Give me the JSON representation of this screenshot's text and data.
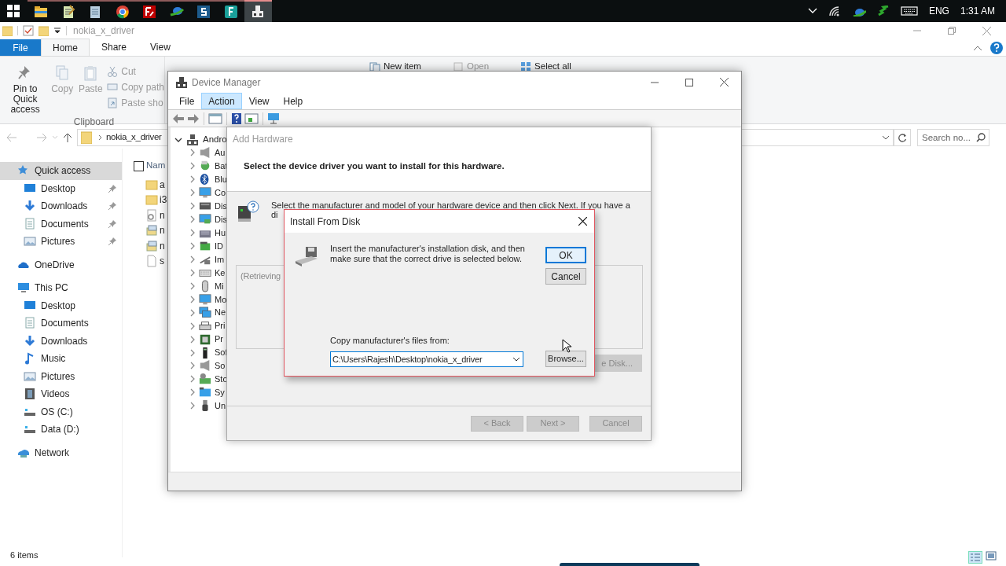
{
  "taskbar": {
    "apps": [
      {
        "kind": "explorer",
        "selected": false
      },
      {
        "kind": "notepad",
        "selected": false
      },
      {
        "kind": "notes",
        "selected": false
      },
      {
        "kind": "browser",
        "selected": false
      },
      {
        "kind": "ftp",
        "selected": false
      },
      {
        "kind": "download",
        "selected": false
      },
      {
        "kind": "letter-s",
        "selected": false
      },
      {
        "kind": "letter-f",
        "selected": false
      },
      {
        "kind": "device",
        "selected": true
      }
    ],
    "tray": {
      "language": "ENG",
      "time": "1:31 AM"
    }
  },
  "explorer": {
    "title": "nokia_x_driver",
    "tabs": [
      {
        "label": "File",
        "kind": "file"
      },
      {
        "label": "Home",
        "kind": "tab",
        "selected": true
      },
      {
        "label": "Share",
        "kind": "tab",
        "selected": false
      },
      {
        "label": "View",
        "kind": "tab",
        "selected": false
      }
    ],
    "ribbon": {
      "large": [
        {
          "label": "Pin to Quick access",
          "kind": "pin",
          "disabled": false
        },
        {
          "label": "Copy",
          "kind": "copy",
          "disabled": true
        },
        {
          "label": "Paste",
          "kind": "paste",
          "disabled": true
        }
      ],
      "small": [
        {
          "label": "Cut",
          "kind": "cut",
          "disabled": true
        },
        {
          "label": "Copy path",
          "kind": "path",
          "disabled": true
        },
        {
          "label": "Paste sho",
          "kind": "shortcut",
          "disabled": true
        }
      ],
      "group_label": "Clipboard",
      "more": [
        {
          "label": "New item",
          "kind": "new",
          "disabled": false
        },
        {
          "label": "Open",
          "kind": "open",
          "disabled": true
        },
        {
          "label": "Select all",
          "kind": "selectall",
          "disabled": false
        }
      ]
    },
    "address": "nokia_x_driver",
    "search_placeholder": "Search no...",
    "nav": [
      {
        "label": "Quick access",
        "kind": "star",
        "selected": true,
        "children": [
          {
            "label": "Desktop",
            "kind": "desktop",
            "pinned": true
          },
          {
            "label": "Downloads",
            "kind": "downloads",
            "pinned": true
          },
          {
            "label": "Documents",
            "kind": "documents",
            "pinned": true
          },
          {
            "label": "Pictures",
            "kind": "pictures",
            "pinned": true
          }
        ]
      },
      {
        "label": "OneDrive",
        "kind": "cloud",
        "selected": false
      },
      {
        "label": "This PC",
        "kind": "pc",
        "selected": false,
        "children": [
          {
            "label": "Desktop",
            "kind": "desktop",
            "pinned": false
          },
          {
            "label": "Documents",
            "kind": "documents",
            "pinned": false
          },
          {
            "label": "Downloads",
            "kind": "downloads",
            "pinned": false
          },
          {
            "label": "Music",
            "kind": "music",
            "pinned": false
          },
          {
            "label": "Pictures",
            "kind": "pictures",
            "pinned": false
          },
          {
            "label": "Videos",
            "kind": "videos",
            "pinned": false
          },
          {
            "label": "OS (C:)",
            "kind": "drive",
            "pinned": false
          },
          {
            "label": "Data (D:)",
            "kind": "drive",
            "pinned": false
          }
        ]
      },
      {
        "label": "Network",
        "kind": "network",
        "selected": false
      }
    ],
    "select_all_checked": false,
    "list_header": "Nam",
    "files": [
      {
        "name": "a",
        "kind": "folder"
      },
      {
        "name": "i3",
        "kind": "folder"
      },
      {
        "name": "n",
        "kind": "settings"
      },
      {
        "name": "n",
        "kind": "setup"
      },
      {
        "name": "n",
        "kind": "setup"
      },
      {
        "name": "s",
        "kind": "file"
      }
    ],
    "status": "6 items"
  },
  "device_manager": {
    "title": "Device Manager",
    "menu": [
      {
        "label": "File",
        "selected": false
      },
      {
        "label": "Action",
        "selected": true
      },
      {
        "label": "View",
        "selected": false
      },
      {
        "label": "Help",
        "selected": false
      }
    ],
    "tree": {
      "label": "Andro",
      "expanded": true,
      "children": [
        {
          "label": "Au",
          "kind": "speaker"
        },
        {
          "label": "Bat",
          "kind": "battery"
        },
        {
          "label": "Blu",
          "kind": "bluetooth"
        },
        {
          "label": "Co",
          "kind": "monitor"
        },
        {
          "label": "Dis",
          "kind": "disk"
        },
        {
          "label": "Dis",
          "kind": "display"
        },
        {
          "label": "Hu",
          "kind": "hid"
        },
        {
          "label": "ID",
          "kind": "ide"
        },
        {
          "label": "Im",
          "kind": "camera"
        },
        {
          "label": "Ke",
          "kind": "keyboard"
        },
        {
          "label": "Mi",
          "kind": "mouse"
        },
        {
          "label": "Mo",
          "kind": "monitor"
        },
        {
          "label": "Ne",
          "kind": "network"
        },
        {
          "label": "Pri",
          "kind": "printer"
        },
        {
          "label": "Pr",
          "kind": "chip"
        },
        {
          "label": "Sof",
          "kind": "tower"
        },
        {
          "label": "So",
          "kind": "speaker"
        },
        {
          "label": "Sto",
          "kind": "storage"
        },
        {
          "label": "Sy",
          "kind": "folder"
        },
        {
          "label": "Un",
          "kind": "usb"
        }
      ]
    }
  },
  "add_hardware": {
    "title": "Add Hardware",
    "heading": "Select the device driver you want to install for this hardware.",
    "description": [
      "Select the manufacturer and model of your hardware device and then click Next. If you have a",
      "di"
    ],
    "list_text": "(Retrieving",
    "have_disk": "e Disk...",
    "buttons": [
      {
        "label": "< Back",
        "disabled": true
      },
      {
        "label": "Next >",
        "disabled": true
      },
      {
        "label": "Cancel",
        "disabled": true
      }
    ]
  },
  "install_from_disk": {
    "title": "Install From Disk",
    "message": "Insert the manufacturer's installation disk, and then make sure that the correct drive is selected below.",
    "buttons": [
      {
        "label": "OK",
        "default": true
      },
      {
        "label": "Cancel",
        "default": false
      }
    ],
    "source_label": "Copy manufacturer's files from:",
    "source_value": "C:\\Users\\Rajesh\\Desktop\\nokia_x_driver",
    "browse": "Browse..."
  }
}
